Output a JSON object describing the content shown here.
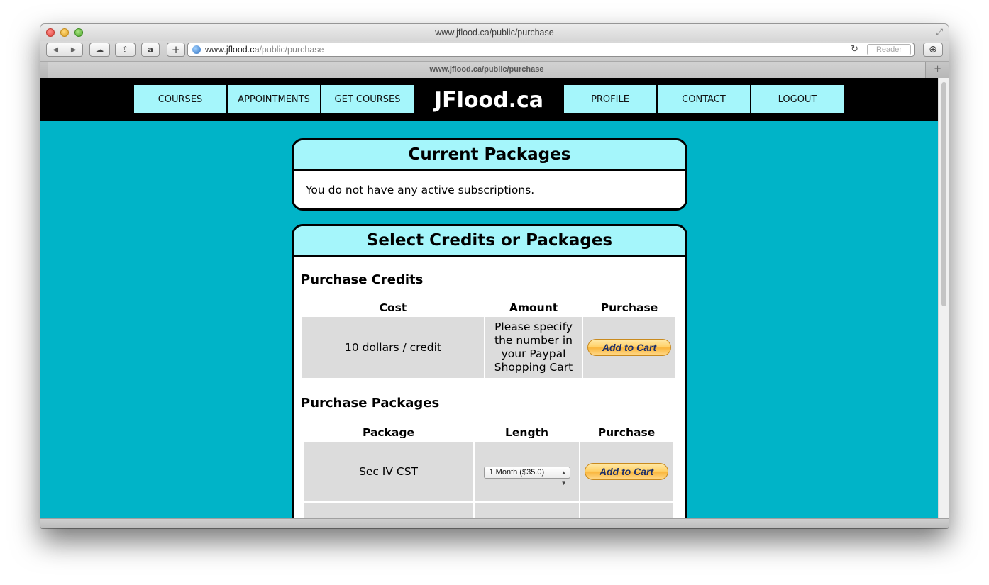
{
  "browser": {
    "window_title": "www.jflood.ca/public/purchase",
    "url_host": "www.jflood.ca",
    "url_path": "/public/purchase",
    "tab_title": "www.jflood.ca/public/purchase",
    "reader_label": "Reader",
    "back_glyph": "◀",
    "forward_glyph": "▶",
    "cloud_glyph": "☁",
    "share_glyph": "⇪",
    "amazon_glyph": "a",
    "add_glyph": "+",
    "reload_glyph": "↻",
    "download_glyph": "⊕",
    "newtab_glyph": "+",
    "resize_glyph": "⤢"
  },
  "site": {
    "brand": "JFlood.ca",
    "nav_left": [
      "COURSES",
      "APPOINTMENTS",
      "GET COURSES"
    ],
    "nav_right": [
      "PROFILE",
      "CONTACT",
      "LOGOUT"
    ]
  },
  "current_packages": {
    "title": "Current Packages",
    "message": "You do not have any active subscriptions."
  },
  "select_panel": {
    "title": "Select Credits or Packages",
    "credits": {
      "title": "Purchase Credits",
      "headers": [
        "Cost",
        "Amount",
        "Purchase"
      ],
      "row": {
        "cost": "10 dollars / credit",
        "amount_lines": [
          "Please specify",
          "the number in",
          "your Paypal",
          "Shopping Cart"
        ],
        "button": "Add to Cart"
      }
    },
    "packages": {
      "title": "Purchase Packages",
      "headers": [
        "Package",
        "Length",
        "Purchase"
      ],
      "rows": [
        {
          "package": "Sec IV CST",
          "length": "1 Month ($35.0)",
          "button": "Add to Cart"
        }
      ]
    }
  }
}
